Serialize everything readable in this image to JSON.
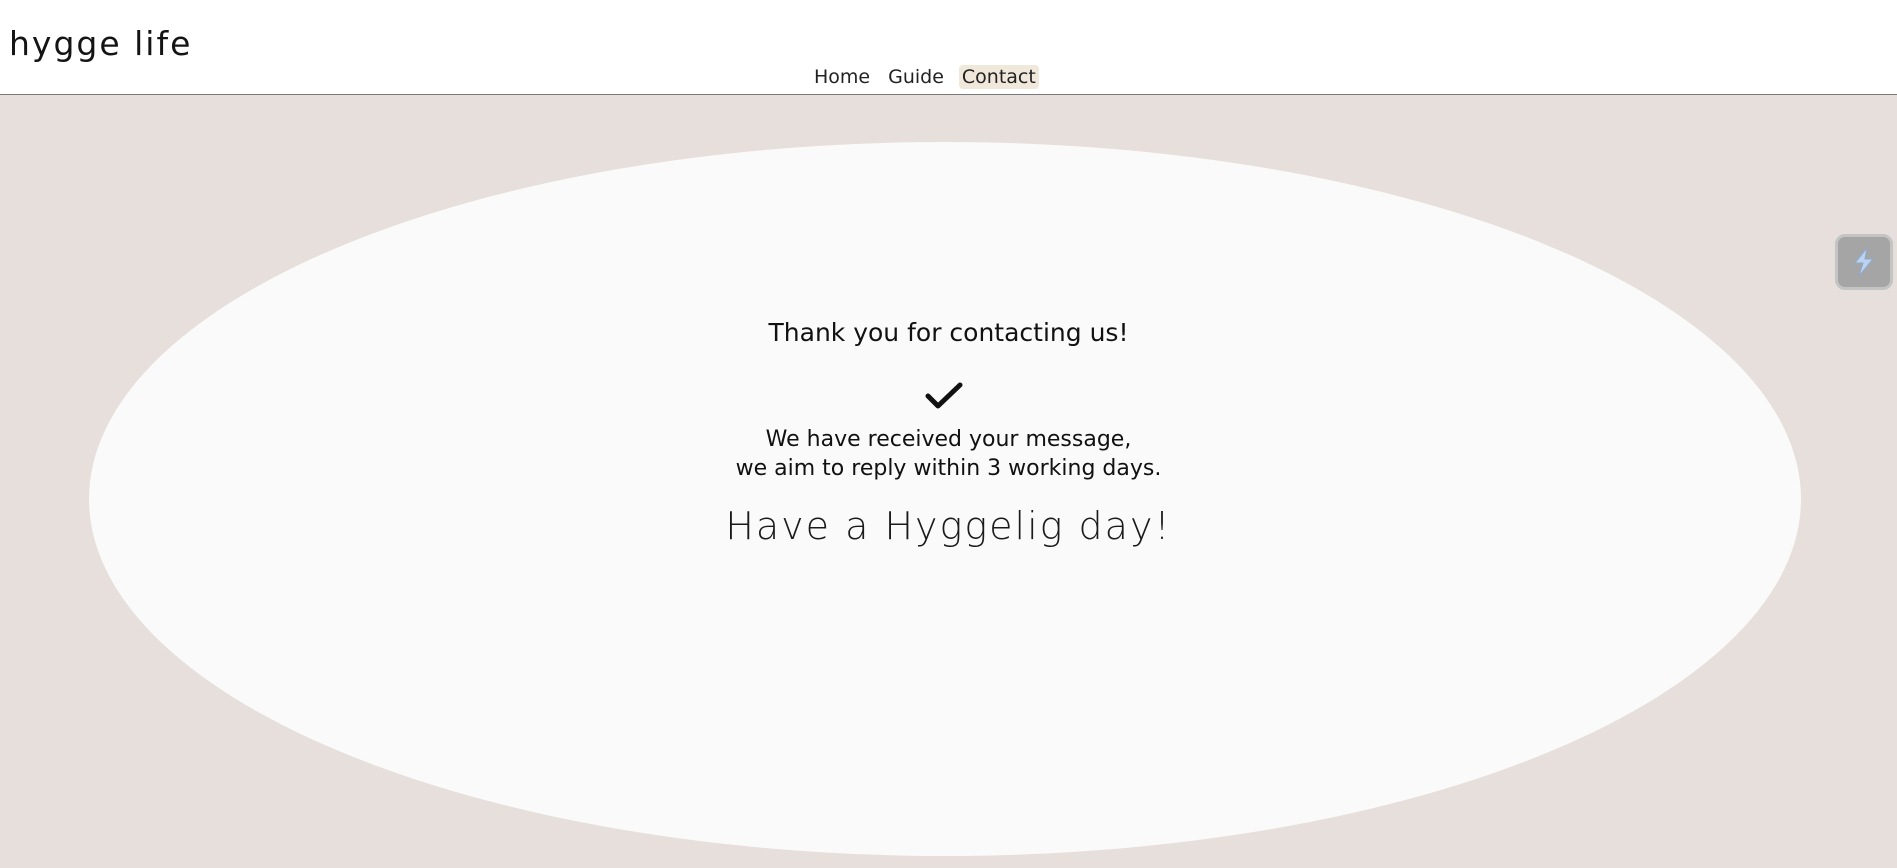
{
  "header": {
    "brand": "hygge life",
    "nav": [
      {
        "label": "Home",
        "active": false
      },
      {
        "label": "Guide",
        "active": false
      },
      {
        "label": "Contact",
        "active": true
      }
    ]
  },
  "confirmation": {
    "title": "Thank you for contacting us!",
    "icon": "checkmark-icon",
    "message_line1": "We have received your message,",
    "message_line2": "we aim to reply within 3 working days.",
    "farewell": "Have a Hyggelig day!"
  },
  "side_widget": {
    "icon": "lightning-icon"
  },
  "colors": {
    "background": "#e6dfdb",
    "card": "#fafafa",
    "active_nav": "#f1e8dc"
  }
}
